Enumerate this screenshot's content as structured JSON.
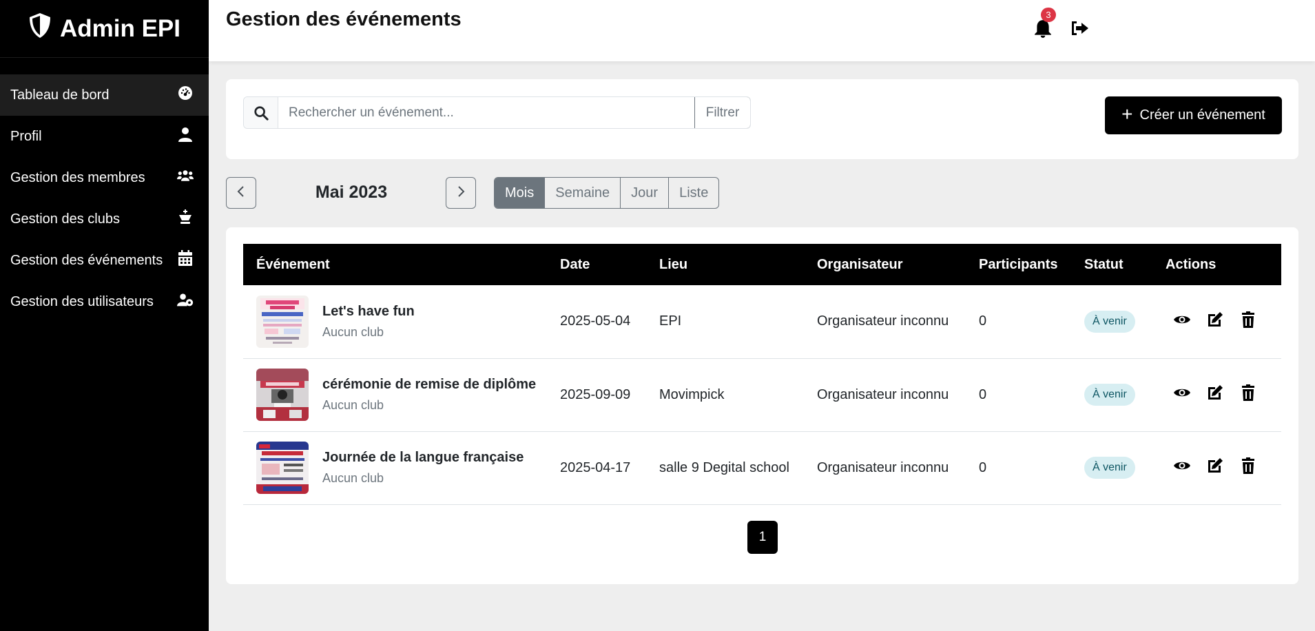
{
  "sidebar": {
    "brand": "Admin EPI",
    "items": [
      {
        "label": "Tableau de bord",
        "icon": "gauge-icon"
      },
      {
        "label": "Profil",
        "icon": "user-icon"
      },
      {
        "label": "Gestion des membres",
        "icon": "users-icon"
      },
      {
        "label": "Gestion des clubs",
        "icon": "chess-king-icon"
      },
      {
        "label": "Gestion des événements",
        "icon": "calendar-icon"
      },
      {
        "label": "Gestion des utilisateurs",
        "icon": "user-cog-icon"
      }
    ]
  },
  "header": {
    "title": "Gestion des événements",
    "notification_count": "3"
  },
  "search": {
    "placeholder": "Rechercher un événement...",
    "value": "",
    "filter_label": "Filtrer",
    "create_label": "Créer un événement"
  },
  "calendar": {
    "month_label": "Mai 2023",
    "views": [
      "Mois",
      "Semaine",
      "Jour",
      "Liste"
    ],
    "active_view": "Mois"
  },
  "table": {
    "headers": [
      "Événement",
      "Date",
      "Lieu",
      "Organisateur",
      "Participants",
      "Statut",
      "Actions"
    ],
    "rows": [
      {
        "title": "Let's have fun",
        "club": "Aucun club",
        "date": "2025-05-04",
        "place": "EPI",
        "organizer": "Organisateur inconnu",
        "participants": "0",
        "status": "À venir"
      },
      {
        "title": "cérémonie de remise de diplôme",
        "club": "Aucun club",
        "date": "2025-09-09",
        "place": "Movimpick",
        "organizer": "Organisateur inconnu",
        "participants": "0",
        "status": "À venir"
      },
      {
        "title": "Journée de la langue française",
        "club": "Aucun club",
        "date": "2025-04-17",
        "place": "salle 9 Degital school",
        "organizer": "Organisateur inconnu",
        "participants": "0",
        "status": "À venir"
      }
    ]
  },
  "pagination": {
    "current_page": "1"
  },
  "colors": {
    "sidebar_bg": "#000000",
    "status_bg": "#d7eef2",
    "notification": "#dc3545"
  }
}
